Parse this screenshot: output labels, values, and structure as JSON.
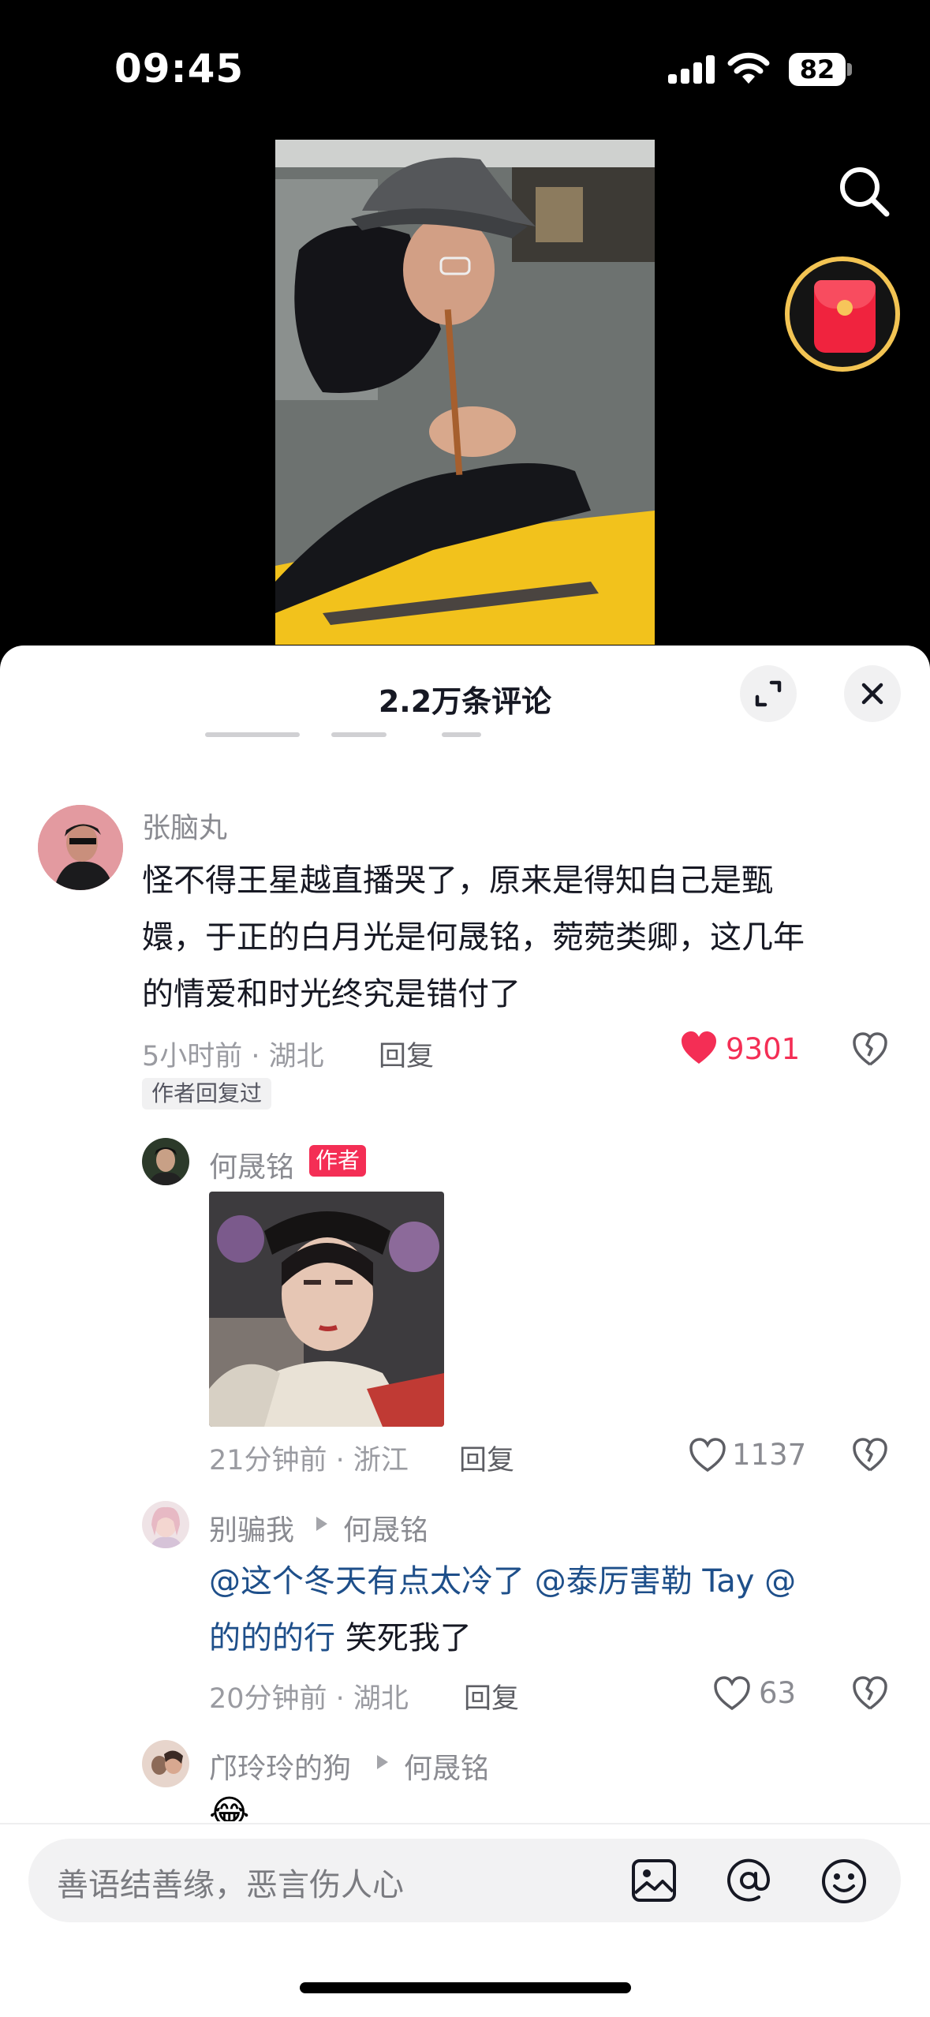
{
  "status": {
    "time": "09:45",
    "battery": "82"
  },
  "comments_header": {
    "title": "2.2万条评论"
  },
  "comments": [
    {
      "username": "张脑丸",
      "text": "怪不得王星越直播哭了，原来是得知自己是甄嬛，于正的白月光是何晟铭，菀菀类卿，这几年的情爱和时光终究是错付了",
      "text_lines": [
        "怪不得王星越直播哭了，原来是得知自己是甄",
        "嬛，于正的白月光是何晟铭，菀菀类卿，这几年",
        "的情爱和时光终究是错付了"
      ],
      "meta": "5小时前 · 湖北",
      "reply_label": "回复",
      "likes": "9301",
      "liked": true,
      "badge": "作者回复过"
    }
  ],
  "replies": [
    {
      "username": "何晟铭",
      "author_tag": "作者",
      "meta": "21分钟前 · 浙江",
      "reply_label": "回复",
      "likes": "1137"
    },
    {
      "username": "别骗我",
      "reply_to": "何晟铭",
      "mention_line1": "@这个冬天有点太冷了 @泰厉害勒 Tay @",
      "mention_line2": "的的的行",
      "text_after": " 笑死我了",
      "meta": "20分钟前 · 湖北",
      "reply_label": "回复",
      "likes": "63"
    },
    {
      "username": "邝玲玲的狗",
      "reply_to": "何晟铭",
      "emoji": "😂"
    }
  ],
  "input": {
    "placeholder": "善语结善缘，恶言伤人心"
  },
  "colors": {
    "like_red": "#f42e55",
    "mention_blue": "#1e4f8a",
    "badge_red": "#f42e55",
    "packet_gold": "#f3c453"
  },
  "icons": [
    "search-icon",
    "red-packet-icon",
    "expand-icon",
    "close-icon",
    "heart-icon",
    "dislike-icon",
    "image-icon",
    "at-icon",
    "emoji-icon"
  ]
}
